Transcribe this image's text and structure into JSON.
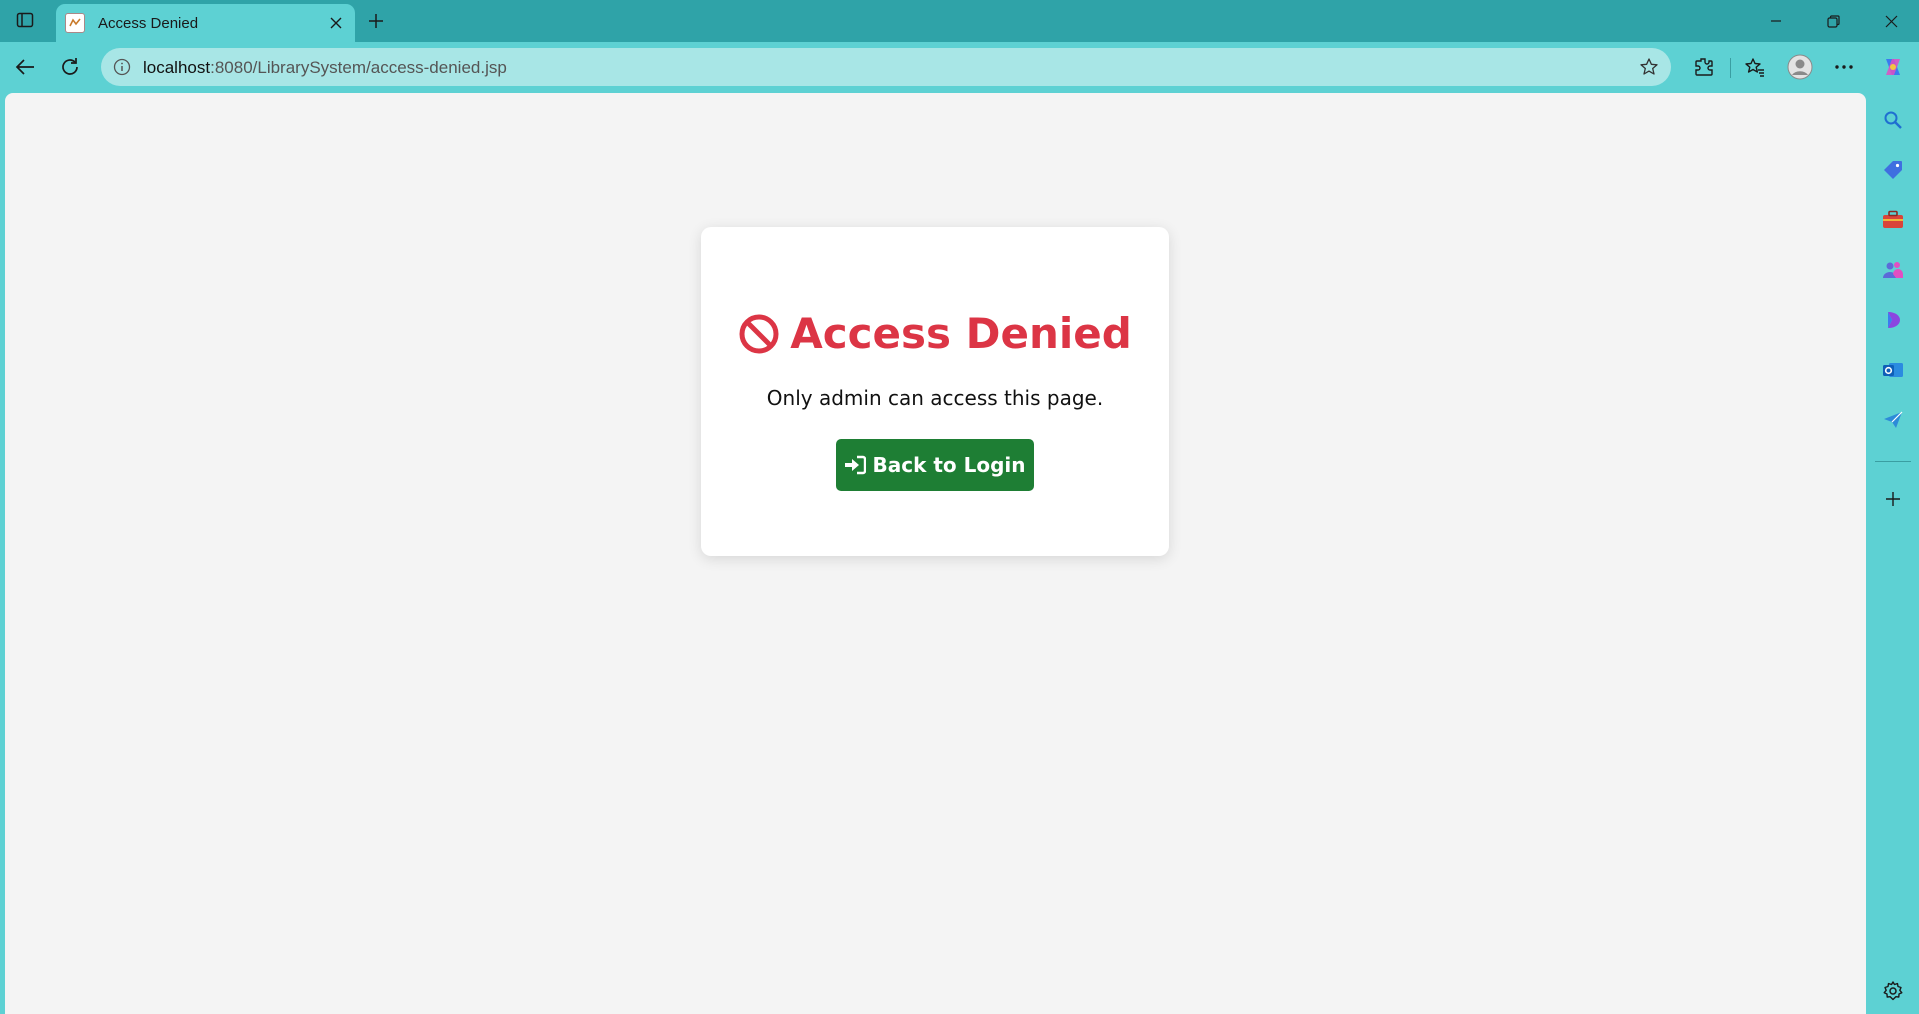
{
  "browser": {
    "tab": {
      "title": "Access Denied"
    },
    "address": {
      "host": "localhost",
      "path": ":8080/LibrarySystem/access-denied.jsp"
    }
  },
  "page": {
    "title": "Access Denied",
    "message": "Only admin can access this page.",
    "button_label": "Back to Login",
    "colors": {
      "title": "#dc3545",
      "button": "#1e7e34",
      "page_background": "#f4f4f4",
      "browser_frame": "#5dd1d3"
    }
  },
  "icons": {
    "title_icon": "ban-icon",
    "button_icon": "sign-in-icon",
    "sidebar": [
      "search-icon",
      "tag-icon",
      "briefcase-icon",
      "people-icon",
      "copilot-icon",
      "outlook-icon",
      "send-icon",
      "add-icon",
      "settings-icon"
    ]
  }
}
